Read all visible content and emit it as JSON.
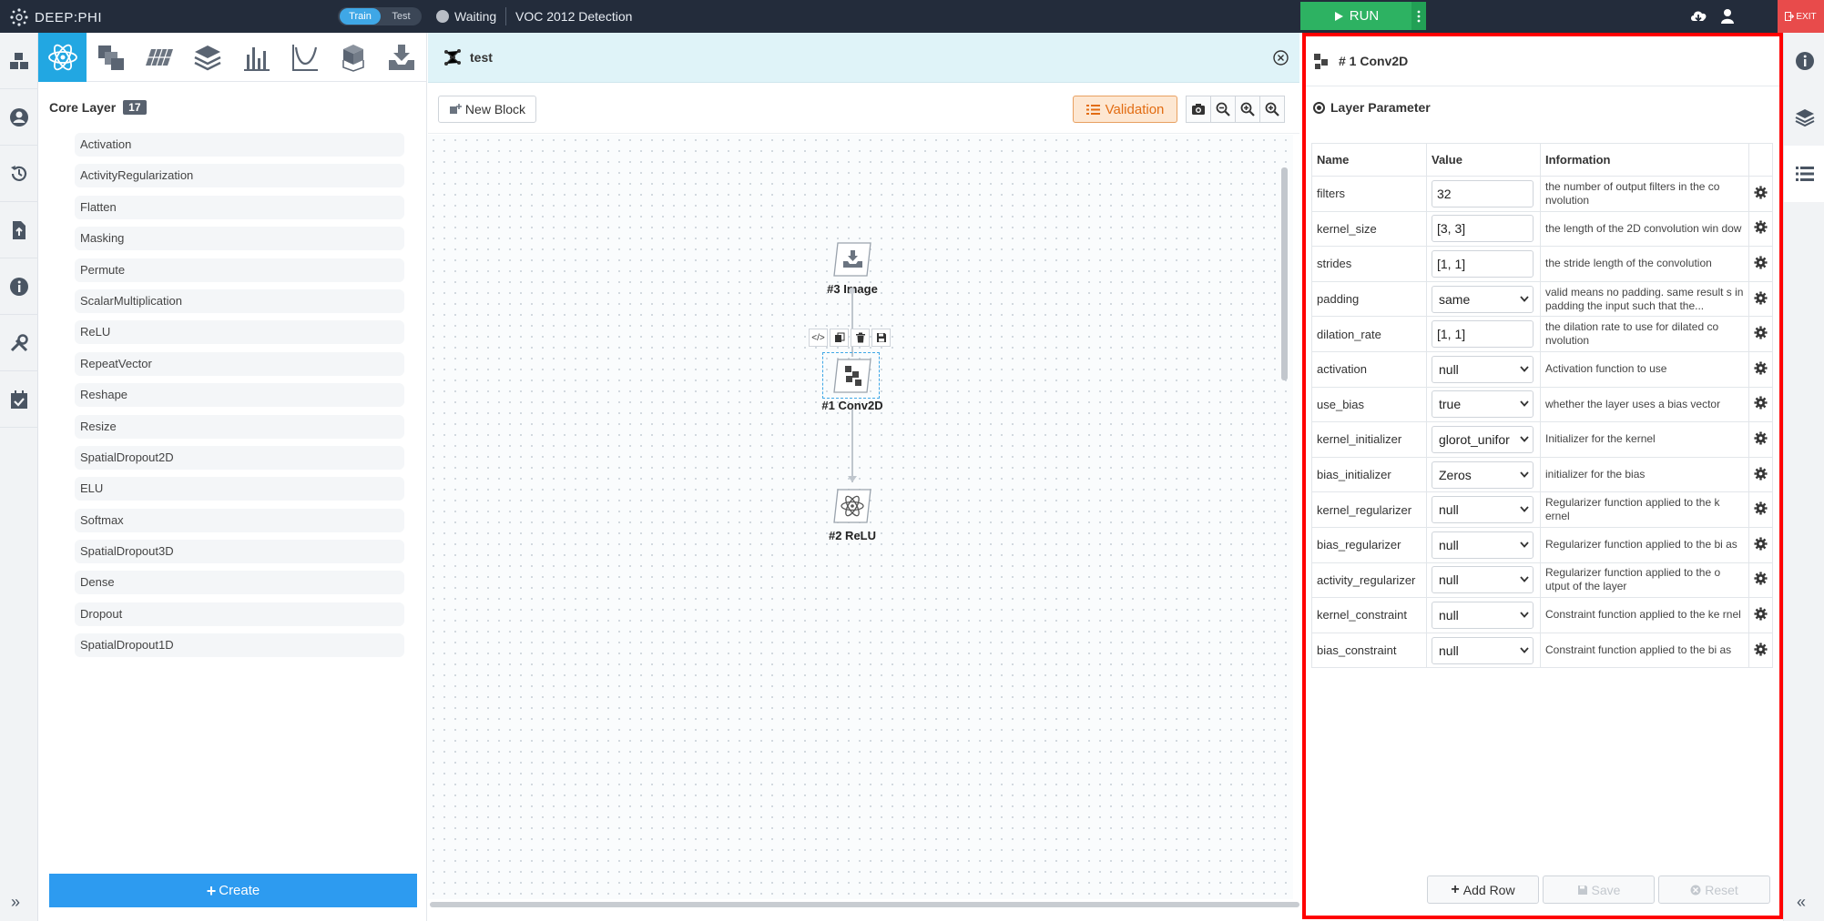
{
  "topbar": {
    "logo": "DEEP:PHI",
    "mode_train": "Train",
    "mode_test": "Test",
    "status": "Waiting",
    "project": "VOC 2012 Detection",
    "run_label": "RUN",
    "exit_label": "EXIT"
  },
  "palette": {
    "title": "Core Layer",
    "count": "17",
    "layers": [
      "Activation",
      "ActivityRegularization",
      "Flatten",
      "Masking",
      "Permute",
      "ScalarMultiplication",
      "ReLU",
      "RepeatVector",
      "Reshape",
      "Resize",
      "SpatialDropout2D",
      "ELU",
      "Softmax",
      "SpatialDropout3D",
      "Dense",
      "Dropout",
      "SpatialDropout1D"
    ],
    "create_label": "Create"
  },
  "canvas": {
    "tab_title": "test",
    "new_block_label": "New Block",
    "validation_label": "Validation",
    "nodes": {
      "image": "#3 Image",
      "conv": "#1 Conv2D",
      "relu": "#2 ReLU"
    }
  },
  "props": {
    "title": "# 1 Conv2D",
    "section": "Layer Parameter",
    "columns": [
      "Name",
      "Value",
      "Information"
    ],
    "rows": [
      {
        "name": "filters",
        "value": "32",
        "kind": "input",
        "info": "the number of output filters in the co nvolution"
      },
      {
        "name": "kernel_size",
        "value": "[3, 3]",
        "kind": "input",
        "info": "the length of the 2D convolution win dow"
      },
      {
        "name": "strides",
        "value": "[1, 1]",
        "kind": "input",
        "info": "the stride length of the convolution"
      },
      {
        "name": "padding",
        "value": "same",
        "kind": "select",
        "info": "valid means no padding. same result s in padding the input such that the..."
      },
      {
        "name": "dilation_rate",
        "value": "[1, 1]",
        "kind": "input",
        "info": "the dilation rate to use for dilated co nvolution"
      },
      {
        "name": "activation",
        "value": "null",
        "kind": "select",
        "info": "Activation function to use"
      },
      {
        "name": "use_bias",
        "value": "true",
        "kind": "select",
        "info": "whether the layer uses a bias vector"
      },
      {
        "name": "kernel_initializer",
        "value": "glorot_unifor",
        "kind": "select",
        "info": "Initializer for the kernel"
      },
      {
        "name": "bias_initializer",
        "value": "Zeros",
        "kind": "select",
        "info": "initializer for the bias"
      },
      {
        "name": "kernel_regularizer",
        "value": "null",
        "kind": "select",
        "info": "Regularizer function applied to the k ernel"
      },
      {
        "name": "bias_regularizer",
        "value": "null",
        "kind": "select",
        "info": "Regularizer function applied to the bi as"
      },
      {
        "name": "activity_regularizer",
        "value": "null",
        "kind": "select",
        "info": "Regularizer function applied to the o utput of the layer"
      },
      {
        "name": "kernel_constraint",
        "value": "null",
        "kind": "select",
        "info": "Constraint function applied to the ke rnel"
      },
      {
        "name": "bias_constraint",
        "value": "null",
        "kind": "select",
        "info": "Constraint function applied to the bi as"
      }
    ],
    "add_row_label": "Add Row",
    "save_label": "Save",
    "reset_label": "Reset"
  },
  "colors": {
    "topbar": "#232c3b",
    "accent": "#22a7e2",
    "run": "#2db262",
    "exit": "#e84b4b",
    "validation": "#e26c12",
    "highlight_border": "#ff0000"
  }
}
